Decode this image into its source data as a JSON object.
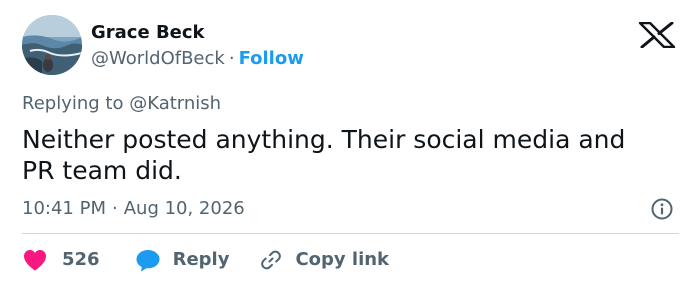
{
  "author": {
    "name": "Grace Beck",
    "handle": "@WorldOfBeck",
    "separator": "·",
    "follow_label": "Follow",
    "avatar_icon": "profile-photo-ocean"
  },
  "platform_icon": "x-logo-icon",
  "tweet": {
    "replying_to": "Replying to @Katrnish",
    "text": "Neither posted anything. Their social media and PR team did.",
    "time": "10:41 PM",
    "separator": "·",
    "date": "Aug 10, 2026"
  },
  "actions": {
    "like_count": "526",
    "reply_label": "Reply",
    "copy_link_label": "Copy link"
  },
  "colors": {
    "follow": "#1d9bf0",
    "like": "#f91880",
    "reply": "#1d9bf0",
    "muted": "#536471",
    "text": "#0f1419",
    "divider": "#cfd9de"
  }
}
